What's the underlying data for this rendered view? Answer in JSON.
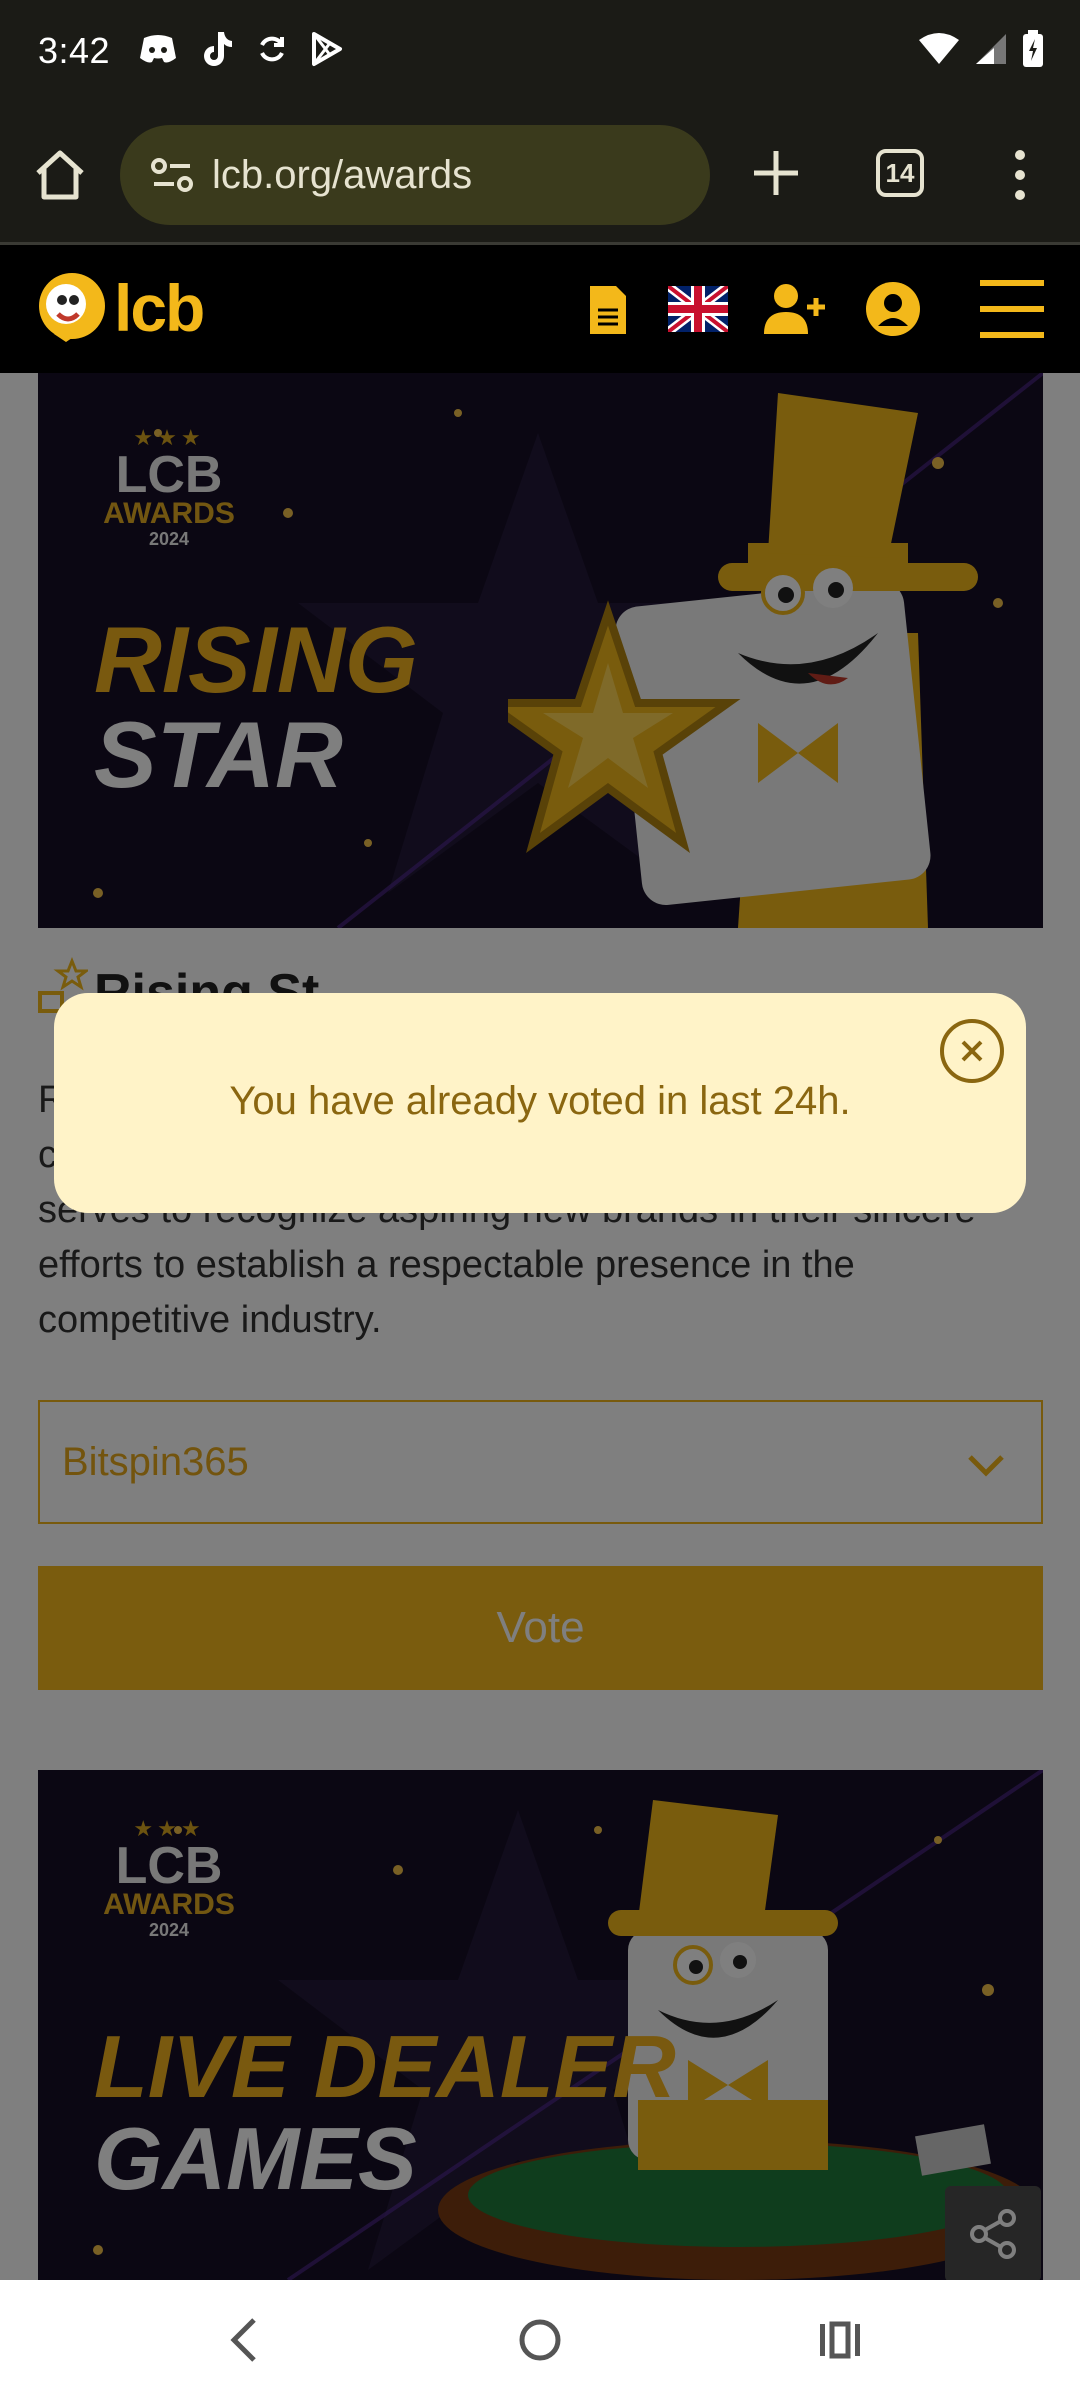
{
  "status_bar": {
    "time": "3:42"
  },
  "browser": {
    "url": "lcb.org/awards",
    "tab_count": "14"
  },
  "site": {
    "logo_text": "lcb"
  },
  "category_1": {
    "badge": {
      "lcb": "LCB",
      "awards": "AWARDS",
      "year": "2024"
    },
    "title_line1": "RISING",
    "title_line2": "STAR",
    "heading": "Rising St",
    "description": "R                                                                                                   c                                                                                                   serves to recognize aspiring new brands in their sincere efforts to establish a respectable presence in the competitive industry.",
    "description_visible": "serves to recognize aspiring new brands in their sincere efforts to establish a respectable presence in the competitive industry.",
    "description_partial_1": "R",
    "description_partial_2": "c",
    "selected_option": "Bitspin365",
    "vote_label": "Vote"
  },
  "category_2": {
    "badge": {
      "lcb": "LCB",
      "awards": "AWARDS",
      "year": "2024"
    },
    "title_line1": "LIVE DEALER",
    "title_line2": "GAMES"
  },
  "toast": {
    "message": "You have already voted in last 24h."
  },
  "colors": {
    "brand": "#f3b81a",
    "toast_bg": "#fff3c8",
    "toast_text": "#8a6610",
    "banner_bg": "#160f26"
  }
}
